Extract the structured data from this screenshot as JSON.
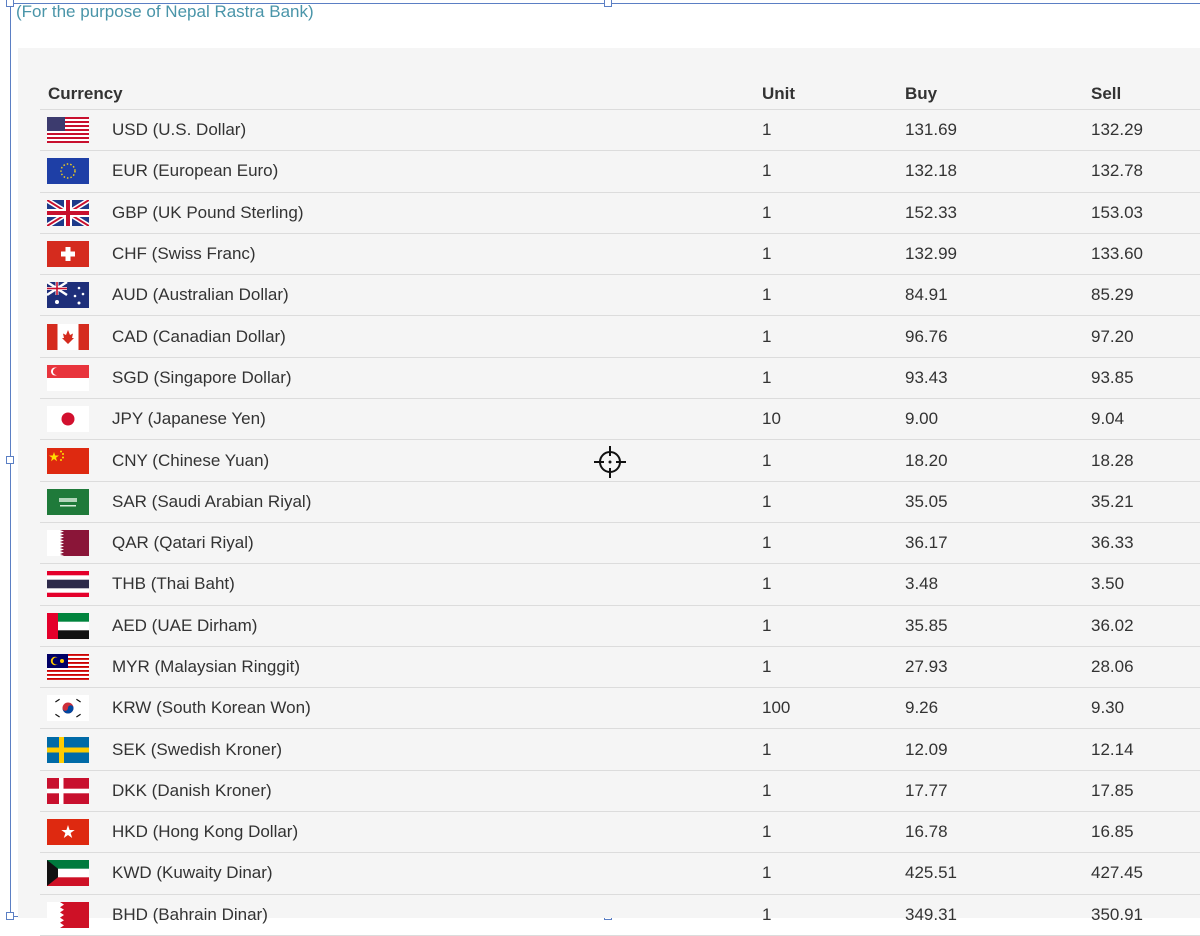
{
  "caption": "(For the purpose of Nepal Rastra Bank)",
  "table": {
    "headers": {
      "currency": "Currency",
      "unit": "Unit",
      "buy": "Buy",
      "sell": "Sell"
    },
    "rows": [
      {
        "flag": "us-flag-icon",
        "name": "USD (U.S. Dollar)",
        "unit": "1",
        "buy": "131.69",
        "sell": "132.29"
      },
      {
        "flag": "eu-flag-icon",
        "name": "EUR (European Euro)",
        "unit": "1",
        "buy": "132.18",
        "sell": "132.78"
      },
      {
        "flag": "uk-flag-icon",
        "name": "GBP (UK Pound Sterling)",
        "unit": "1",
        "buy": "152.33",
        "sell": "153.03"
      },
      {
        "flag": "swiss-flag-icon",
        "name": "CHF (Swiss Franc)",
        "unit": "1",
        "buy": "132.99",
        "sell": "133.60"
      },
      {
        "flag": "australia-flag-icon",
        "name": "AUD (Australian Dollar)",
        "unit": "1",
        "buy": "84.91",
        "sell": "85.29"
      },
      {
        "flag": "canada-flag-icon",
        "name": "CAD (Canadian Dollar)",
        "unit": "1",
        "buy": "96.76",
        "sell": "97.20"
      },
      {
        "flag": "singapore-flag-icon",
        "name": "SGD (Singapore Dollar)",
        "unit": "1",
        "buy": "93.43",
        "sell": "93.85"
      },
      {
        "flag": "japan-flag-icon",
        "name": "JPY (Japanese Yen)",
        "unit": "10",
        "buy": "9.00",
        "sell": "9.04"
      },
      {
        "flag": "china-flag-icon",
        "name": "CNY (Chinese Yuan)",
        "unit": "1",
        "buy": "18.20",
        "sell": "18.28"
      },
      {
        "flag": "saudi-flag-icon",
        "name": "SAR (Saudi Arabian Riyal)",
        "unit": "1",
        "buy": "35.05",
        "sell": "35.21"
      },
      {
        "flag": "qatar-flag-icon",
        "name": "QAR (Qatari Riyal)",
        "unit": "1",
        "buy": "36.17",
        "sell": "36.33"
      },
      {
        "flag": "thailand-flag-icon",
        "name": "THB (Thai Baht)",
        "unit": "1",
        "buy": "3.48",
        "sell": "3.50"
      },
      {
        "flag": "uae-flag-icon",
        "name": "AED (UAE Dirham)",
        "unit": "1",
        "buy": "35.85",
        "sell": "36.02"
      },
      {
        "flag": "malaysia-flag-icon",
        "name": "MYR (Malaysian Ringgit)",
        "unit": "1",
        "buy": "27.93",
        "sell": "28.06"
      },
      {
        "flag": "korea-flag-icon",
        "name": "KRW (South Korean Won)",
        "unit": "100",
        "buy": "9.26",
        "sell": "9.30"
      },
      {
        "flag": "sweden-flag-icon",
        "name": "SEK (Swedish Kroner)",
        "unit": "1",
        "buy": "12.09",
        "sell": "12.14"
      },
      {
        "flag": "denmark-flag-icon",
        "name": "DKK (Danish Kroner)",
        "unit": "1",
        "buy": "17.77",
        "sell": "17.85"
      },
      {
        "flag": "hongkong-flag-icon",
        "name": "HKD (Hong Kong Dollar)",
        "unit": "1",
        "buy": "16.78",
        "sell": "16.85"
      },
      {
        "flag": "kuwait-flag-icon",
        "name": "KWD (Kuwaity Dinar)",
        "unit": "1",
        "buy": "425.51",
        "sell": "427.45"
      },
      {
        "flag": "bahrain-flag-icon",
        "name": "BHD (Bahrain Dinar)",
        "unit": "1",
        "buy": "349.31",
        "sell": "350.91"
      }
    ]
  },
  "colors": {
    "caption": "#4a95a9",
    "selection": "#5b7fc4",
    "panel": "#f5f5f5",
    "divider": "#dcdcdc"
  }
}
